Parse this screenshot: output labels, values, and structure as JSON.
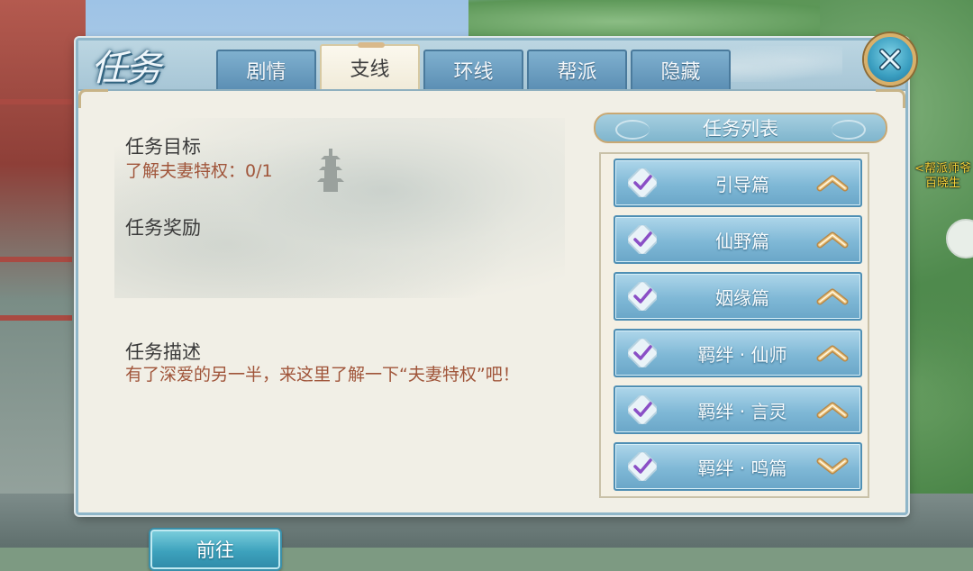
{
  "panel": {
    "title": "任务",
    "tabs": [
      {
        "label": "剧情",
        "active": false
      },
      {
        "label": "支线",
        "active": true
      },
      {
        "label": "环线",
        "active": false
      },
      {
        "label": "帮派",
        "active": false
      },
      {
        "label": "隐藏",
        "active": false
      }
    ]
  },
  "detail": {
    "goal_title": "任务目标",
    "goal_text": "了解夫妻特权：0/1",
    "reward_title": "任务奖励",
    "desc_title": "任务描述",
    "desc_text": "有了深爱的另一半，来这里了解一下“夫妻特权”吧！",
    "go_button": "前往"
  },
  "quest_list": {
    "title": "任务列表",
    "items": [
      {
        "label": "引导篇",
        "expanded": false
      },
      {
        "label": "仙野篇",
        "expanded": false
      },
      {
        "label": "姻缘篇",
        "expanded": false
      },
      {
        "label": "羁绊 · 仙师",
        "expanded": false
      },
      {
        "label": "羁绊 · 言灵",
        "expanded": false
      },
      {
        "label": "羁绊 · 鸣篇",
        "expanded": true
      }
    ]
  },
  "world": {
    "npc_label": "<帮派师爷\n百晓生"
  },
  "colors": {
    "accent_text": "#a0553a",
    "tab_blue": "#5c8fb4",
    "panel_bg": "#f1efe6",
    "chevron_gold": "#e9c27a",
    "check_purple": "#8a4fc6"
  }
}
